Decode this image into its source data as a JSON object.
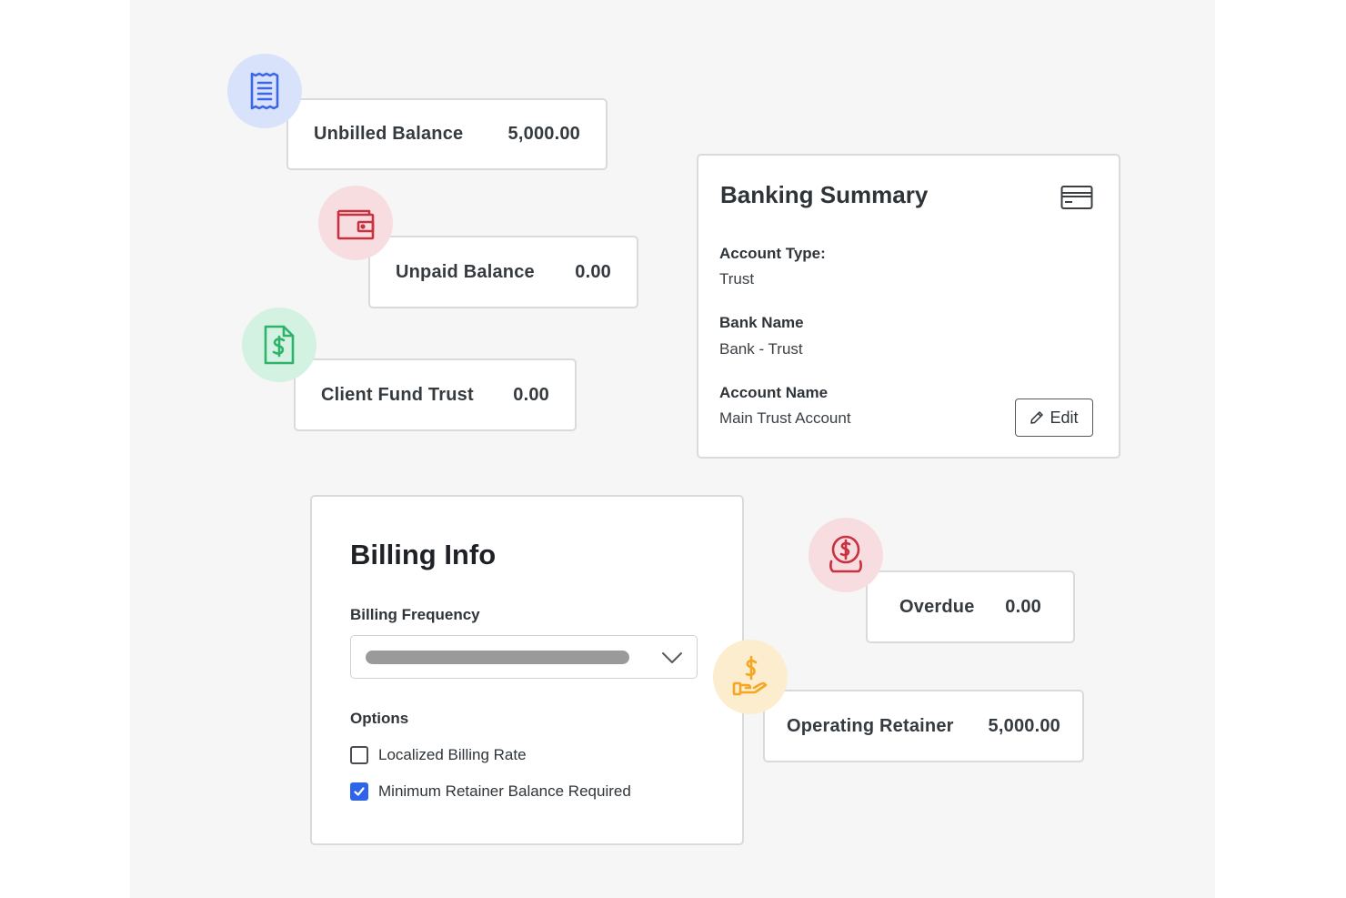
{
  "balances": {
    "unbilled": {
      "label": "Unbilled Balance",
      "value": "5,000.00",
      "icon": "receipt-icon"
    },
    "unpaid": {
      "label": "Unpaid Balance",
      "value": "0.00",
      "icon": "wallet-icon"
    },
    "client_fund_trust": {
      "label": "Client Fund Trust",
      "value": "0.00",
      "icon": "dollar-document-icon"
    },
    "overdue": {
      "label": "Overdue",
      "value": "0.00",
      "icon": "dollar-coin-hand-icon"
    },
    "operating_retainer": {
      "label": "Operating Retainer",
      "value": "5,000.00",
      "icon": "dollar-hand-icon"
    }
  },
  "banking_summary": {
    "title": "Banking Summary",
    "icon": "credit-card-icon",
    "account_type_label": "Account Type:",
    "account_type_value": "Trust",
    "bank_name_label": "Bank Name",
    "bank_name_value": "Bank - Trust",
    "account_name_label": "Account Name",
    "account_name_value": "Main Trust Account",
    "edit_label": "Edit"
  },
  "billing_info": {
    "title": "Billing Info",
    "frequency_label": "Billing Frequency",
    "options_label": "Options",
    "options": [
      {
        "label": "Localized Billing Rate",
        "checked": false
      },
      {
        "label": "Minimum Retainer Balance Required",
        "checked": true
      }
    ]
  },
  "colors": {
    "blue_icon": "#3b66e6",
    "blue_bg": "#d9e2fb",
    "red_icon": "#c8313f",
    "red_bg": "#f8dde0",
    "green_icon": "#2fb36b",
    "green_bg": "#d3f2e1",
    "orange_icon": "#f5a623",
    "orange_bg": "#fdedcf",
    "checkbox_checked": "#2f63e8"
  }
}
